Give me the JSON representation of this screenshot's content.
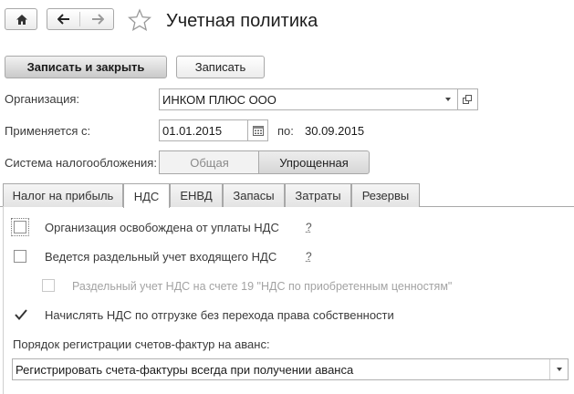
{
  "window": {
    "title": "Учетная политика"
  },
  "toolbar": {
    "save_close_label": "Записать и закрыть",
    "save_label": "Записать"
  },
  "form": {
    "org_label": "Организация:",
    "org_value": "ИНКОМ ПЛЮС ООО",
    "applies_label": "Применяется с:",
    "date_from": "01.01.2015",
    "to_label": "по:",
    "date_to": "30.09.2015",
    "tax_label": "Система налогообложения:",
    "tax_options": [
      "Общая",
      "Упрощенная"
    ],
    "tax_selected": "Упрощенная"
  },
  "tabs": [
    {
      "label": "Налог на прибыль"
    },
    {
      "label": "НДС"
    },
    {
      "label": "ЕНВД"
    },
    {
      "label": "Запасы"
    },
    {
      "label": "Затраты"
    },
    {
      "label": "Резервы"
    }
  ],
  "active_tab": "НДС",
  "vat": {
    "options": [
      {
        "label": "Организация освобождена от уплаты НДС",
        "checked": false,
        "help": "?"
      },
      {
        "label": "Ведется раздельный учет входящего НДС",
        "checked": false,
        "help": "?"
      },
      {
        "label": "Раздельный учет НДС на счете 19 \"НДС по приобретенным ценностям\"",
        "checked": false,
        "disabled": true
      },
      {
        "label": "Начислять НДС по отгрузке без перехода права собственности",
        "checked": true
      }
    ],
    "invoice_order_label": "Порядок регистрации счетов-фактур на аванс:",
    "invoice_order_value": "Регистрировать счета-фактуры всегда при получении аванса"
  }
}
